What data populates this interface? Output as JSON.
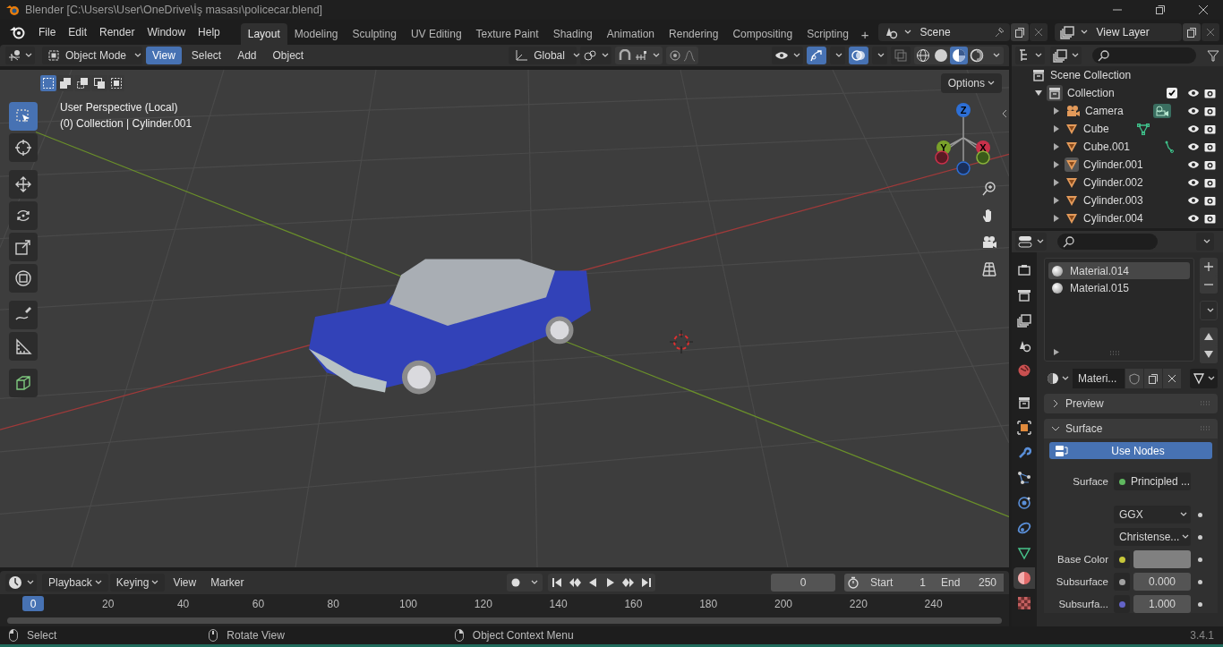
{
  "window": {
    "title": "Blender [C:\\Users\\User\\OneDrive\\İş masası\\policecar.blend]"
  },
  "menus": [
    "File",
    "Edit",
    "Render",
    "Window",
    "Help"
  ],
  "workspaces": [
    {
      "label": "Layout",
      "selected": true
    },
    {
      "label": "Modeling",
      "selected": false
    },
    {
      "label": "Sculpting",
      "selected": false
    },
    {
      "label": "UV Editing",
      "selected": false
    },
    {
      "label": "Texture Paint",
      "selected": false
    },
    {
      "label": "Shading",
      "selected": false
    },
    {
      "label": "Animation",
      "selected": false
    },
    {
      "label": "Rendering",
      "selected": false
    },
    {
      "label": "Compositing",
      "selected": false
    },
    {
      "label": "Scripting",
      "selected": false
    }
  ],
  "add_workspace": "+",
  "scene": "Scene",
  "view_layer": "View Layer",
  "viewport": {
    "mode": "Object Mode",
    "menus": [
      {
        "label": "View",
        "selected": true
      },
      {
        "label": "Select",
        "selected": false
      },
      {
        "label": "Add",
        "selected": false
      },
      {
        "label": "Object",
        "selected": false
      }
    ],
    "orientation": "Global",
    "shading": [
      {
        "kind": "wireframe",
        "selected": false
      },
      {
        "kind": "solid",
        "selected": false
      },
      {
        "kind": "material",
        "selected": true
      },
      {
        "kind": "rendered",
        "selected": false
      }
    ],
    "select_modes": [
      {
        "selected": true
      },
      {
        "selected": false
      },
      {
        "selected": false
      },
      {
        "selected": false
      },
      {
        "selected": false
      }
    ],
    "options": "Options",
    "info": [
      "User Perspective (Local)",
      "(0) Collection | Cylinder.001"
    ],
    "tools": [
      {
        "kind": "select",
        "selected": true
      },
      {
        "kind": "cursor",
        "selected": false
      },
      {
        "kind": "move",
        "selected": false
      },
      {
        "kind": "rotate",
        "selected": false
      },
      {
        "kind": "scale",
        "selected": false
      },
      {
        "kind": "transform",
        "selected": false
      },
      {
        "kind": "annotate",
        "selected": false
      },
      {
        "kind": "measure",
        "selected": false
      },
      {
        "kind": "addcube",
        "selected": false
      }
    ],
    "gizmo": [
      "Z",
      "Y",
      "X"
    ]
  },
  "outliner": {
    "root": "Scene Collection",
    "collection": {
      "name": "Collection",
      "expanded": true,
      "checked": true,
      "children": [
        {
          "name": "Camera",
          "kind": "camera",
          "selected": false
        },
        {
          "name": "Cube",
          "kind": "mesh_data",
          "selected": false
        },
        {
          "name": "Cube.001",
          "kind": "mesh_edges",
          "selected": false
        },
        {
          "name": "Cylinder.001",
          "kind": "mesh",
          "selected": true
        },
        {
          "name": "Cylinder.002",
          "kind": "mesh",
          "selected": false
        },
        {
          "name": "Cylinder.003",
          "kind": "mesh",
          "selected": false
        },
        {
          "name": "Cylinder.004",
          "kind": "mesh",
          "selected": false
        }
      ]
    }
  },
  "properties": {
    "tabs": [
      {
        "kind": "render",
        "selected": false
      },
      {
        "kind": "output",
        "selected": false
      },
      {
        "kind": "viewlayer",
        "selected": false
      },
      {
        "kind": "scene",
        "selected": false
      },
      {
        "kind": "world",
        "selected": false
      },
      {
        "kind": "collection",
        "selected": false
      },
      {
        "kind": "object",
        "selected": false
      },
      {
        "kind": "modifier",
        "selected": false
      },
      {
        "kind": "particles",
        "selected": false
      },
      {
        "kind": "physics",
        "selected": false
      },
      {
        "kind": "constraints",
        "selected": false
      },
      {
        "kind": "data",
        "selected": false
      },
      {
        "kind": "material",
        "selected": true
      },
      {
        "kind": "texture",
        "selected": false
      }
    ],
    "materials": [
      {
        "name": "Material.014",
        "selected": true
      },
      {
        "name": "Material.015",
        "selected": false
      }
    ],
    "material_name": "Materi...",
    "panels": [
      {
        "label": "Preview",
        "expanded": false
      },
      {
        "label": "Surface",
        "expanded": true
      }
    ],
    "use_nodes": "Use Nodes",
    "fields": [
      {
        "kind": "node",
        "label": "Surface",
        "value": "Principled ...",
        "color": "#5fb85f"
      },
      {
        "kind": "dropdown",
        "value": "GGX"
      },
      {
        "kind": "dropdown",
        "value": "Christense..."
      },
      {
        "kind": "color",
        "label": "Base Color",
        "color": "#c7c73a"
      },
      {
        "kind": "number",
        "label": "Subsurface",
        "value": "0.000",
        "color": "#a1a1a1"
      },
      {
        "kind": "number",
        "label": "Subsurfa...",
        "value": "1.000",
        "color": "#6363c7"
      }
    ]
  },
  "timeline": {
    "menus": [
      "Playback",
      "Keying",
      "View",
      "Marker"
    ],
    "current_frame": "0",
    "start_label": "Start",
    "start": "1",
    "end_label": "End",
    "end": "250",
    "playhead": "0",
    "ruler": [
      "20",
      "40",
      "60",
      "80",
      "100",
      "120",
      "140",
      "160",
      "180",
      "200",
      "220",
      "240"
    ]
  },
  "status_bar": {
    "hints": [
      "Select",
      "Rotate View",
      "Object Context Menu"
    ],
    "version": "3.4.1"
  }
}
